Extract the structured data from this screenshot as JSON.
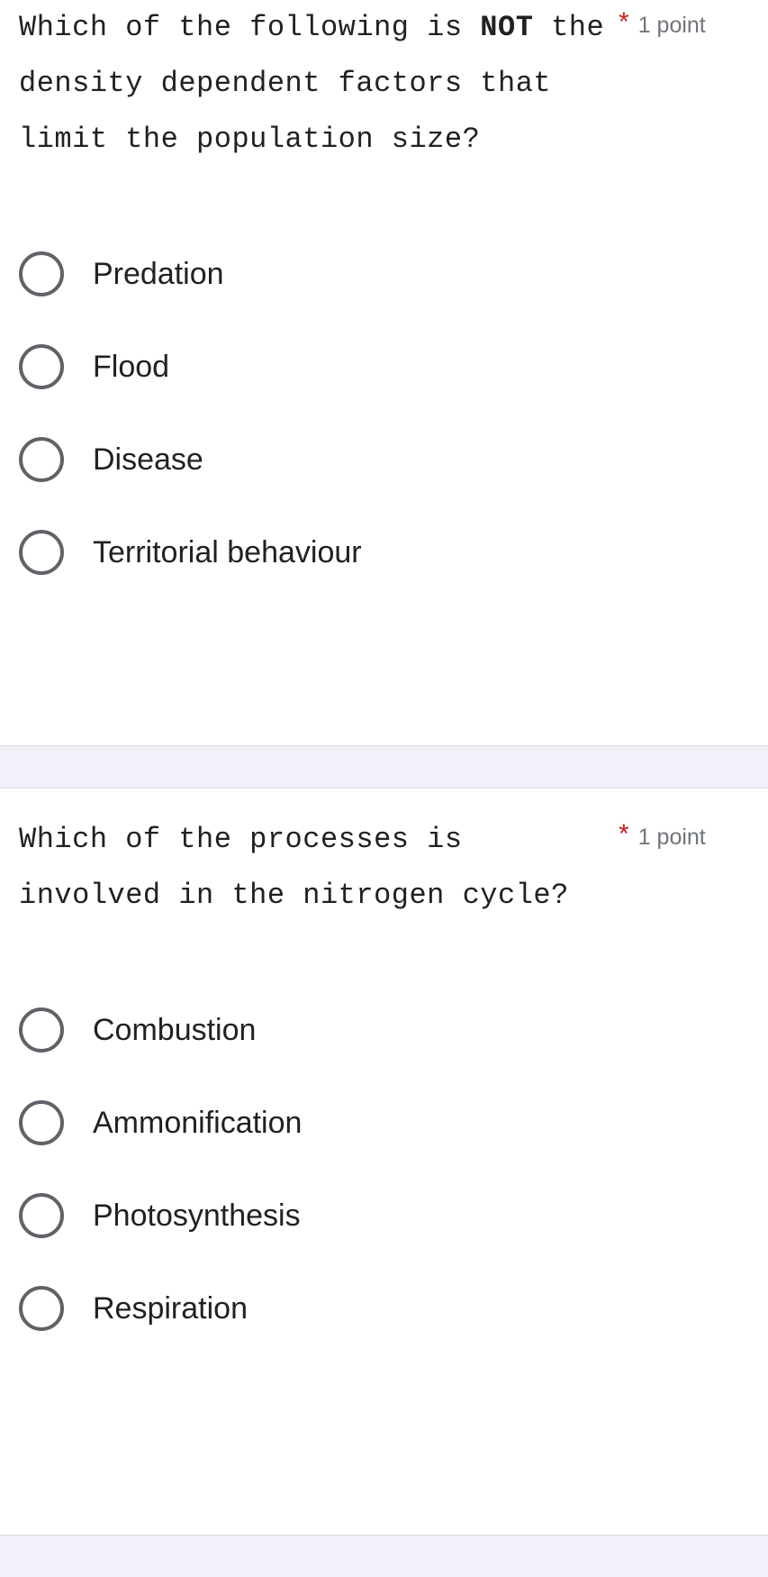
{
  "form": {
    "accent_color": "#673ab7",
    "background_color": "#f3f0f9",
    "card_background": "#ffffff",
    "required_star_color": "#c5221f",
    "text_color": "#202124",
    "muted_text_color": "#70757a",
    "radio_border_color": "#5f6368"
  },
  "questions": [
    {
      "id": "q1",
      "title_part1": "Which of the following is ",
      "title_bold": "NOT",
      "title_part2": " the density dependent factors that limit the population size?",
      "title_full": "Which of the following is NOT the density dependent factors that limit the population size?",
      "required_marker": "*",
      "points": "1 point",
      "options": [
        {
          "label": "Predation",
          "selected": false
        },
        {
          "label": "Flood",
          "selected": false
        },
        {
          "label": "Disease",
          "selected": false
        },
        {
          "label": "Territorial behaviour",
          "selected": false
        }
      ]
    },
    {
      "id": "q2",
      "title_part1": "Which of the processes is involved in the nitrogen cycle?",
      "title_bold": "",
      "title_part2": "",
      "title_full": "Which of the processes is involved in the nitrogen cycle?",
      "required_marker": "*",
      "points": "1 point",
      "options": [
        {
          "label": "Combustion",
          "selected": false
        },
        {
          "label": "Ammonification",
          "selected": false
        },
        {
          "label": "Photosynthesis",
          "selected": false
        },
        {
          "label": "Respiration",
          "selected": false
        }
      ]
    }
  ]
}
